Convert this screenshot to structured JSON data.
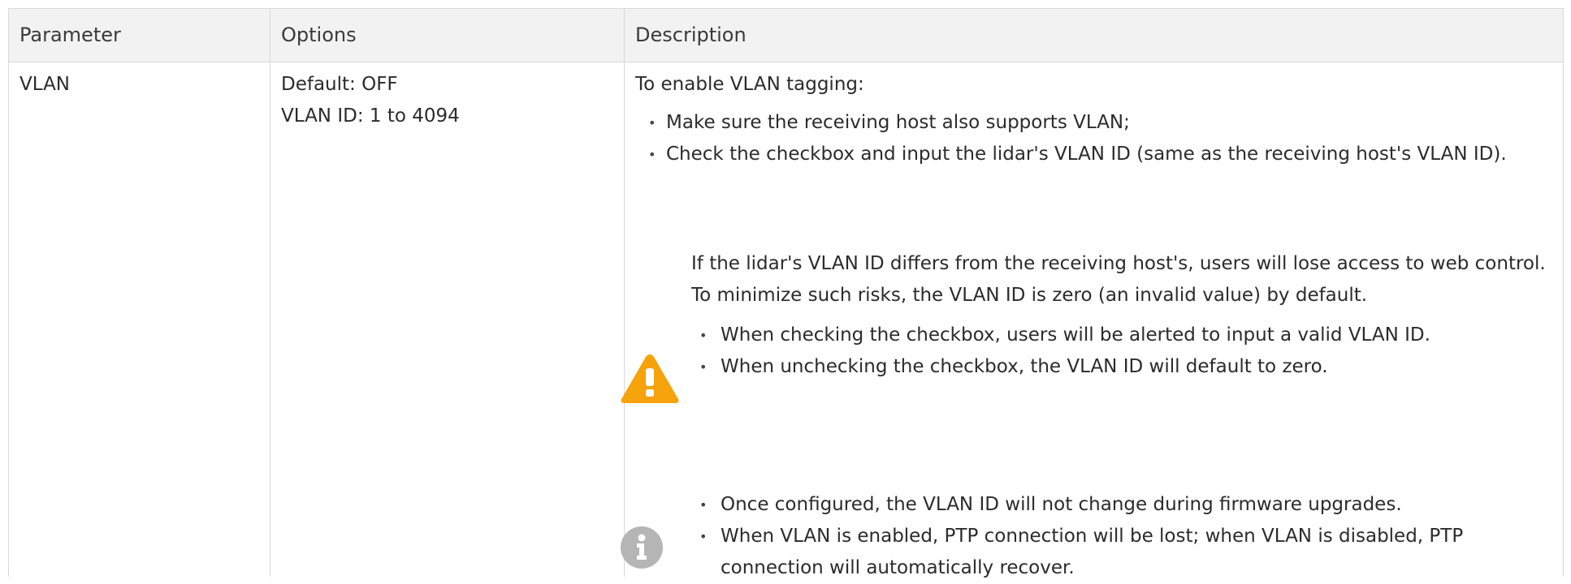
{
  "table": {
    "headers": {
      "parameter": "Parameter",
      "options": "Options",
      "description": "Description"
    },
    "rows": [
      {
        "parameter": "VLAN",
        "options": [
          "Default: OFF",
          "VLAN ID: 1 to 4094"
        ],
        "description": {
          "intro": "To enable VLAN tagging:",
          "steps": [
            "Make sure the receiving host also supports VLAN;",
            "Check the checkbox and input the lidar's VLAN ID (same as the receiving host's VLAN ID)."
          ],
          "warning": {
            "icon": "warning-icon",
            "color": "#f5a20b",
            "text": "If the lidar's VLAN ID differs from the receiving host's, users will lose access to web control. To minimize such risks, the VLAN ID is zero (an invalid value) by default.",
            "items": [
              "When checking the checkbox, users will be alerted to input a valid VLAN ID.",
              "When unchecking the checkbox, the VLAN ID will default to zero."
            ]
          },
          "info": {
            "icon": "info-icon",
            "color": "#b5b5b5",
            "items": [
              "Once configured, the VLAN ID will not change during firmware upgrades.",
              "When VLAN is enabled, PTP connection will be lost; when VLAN is disabled, PTP connection will automatically recover."
            ]
          }
        }
      }
    ]
  }
}
